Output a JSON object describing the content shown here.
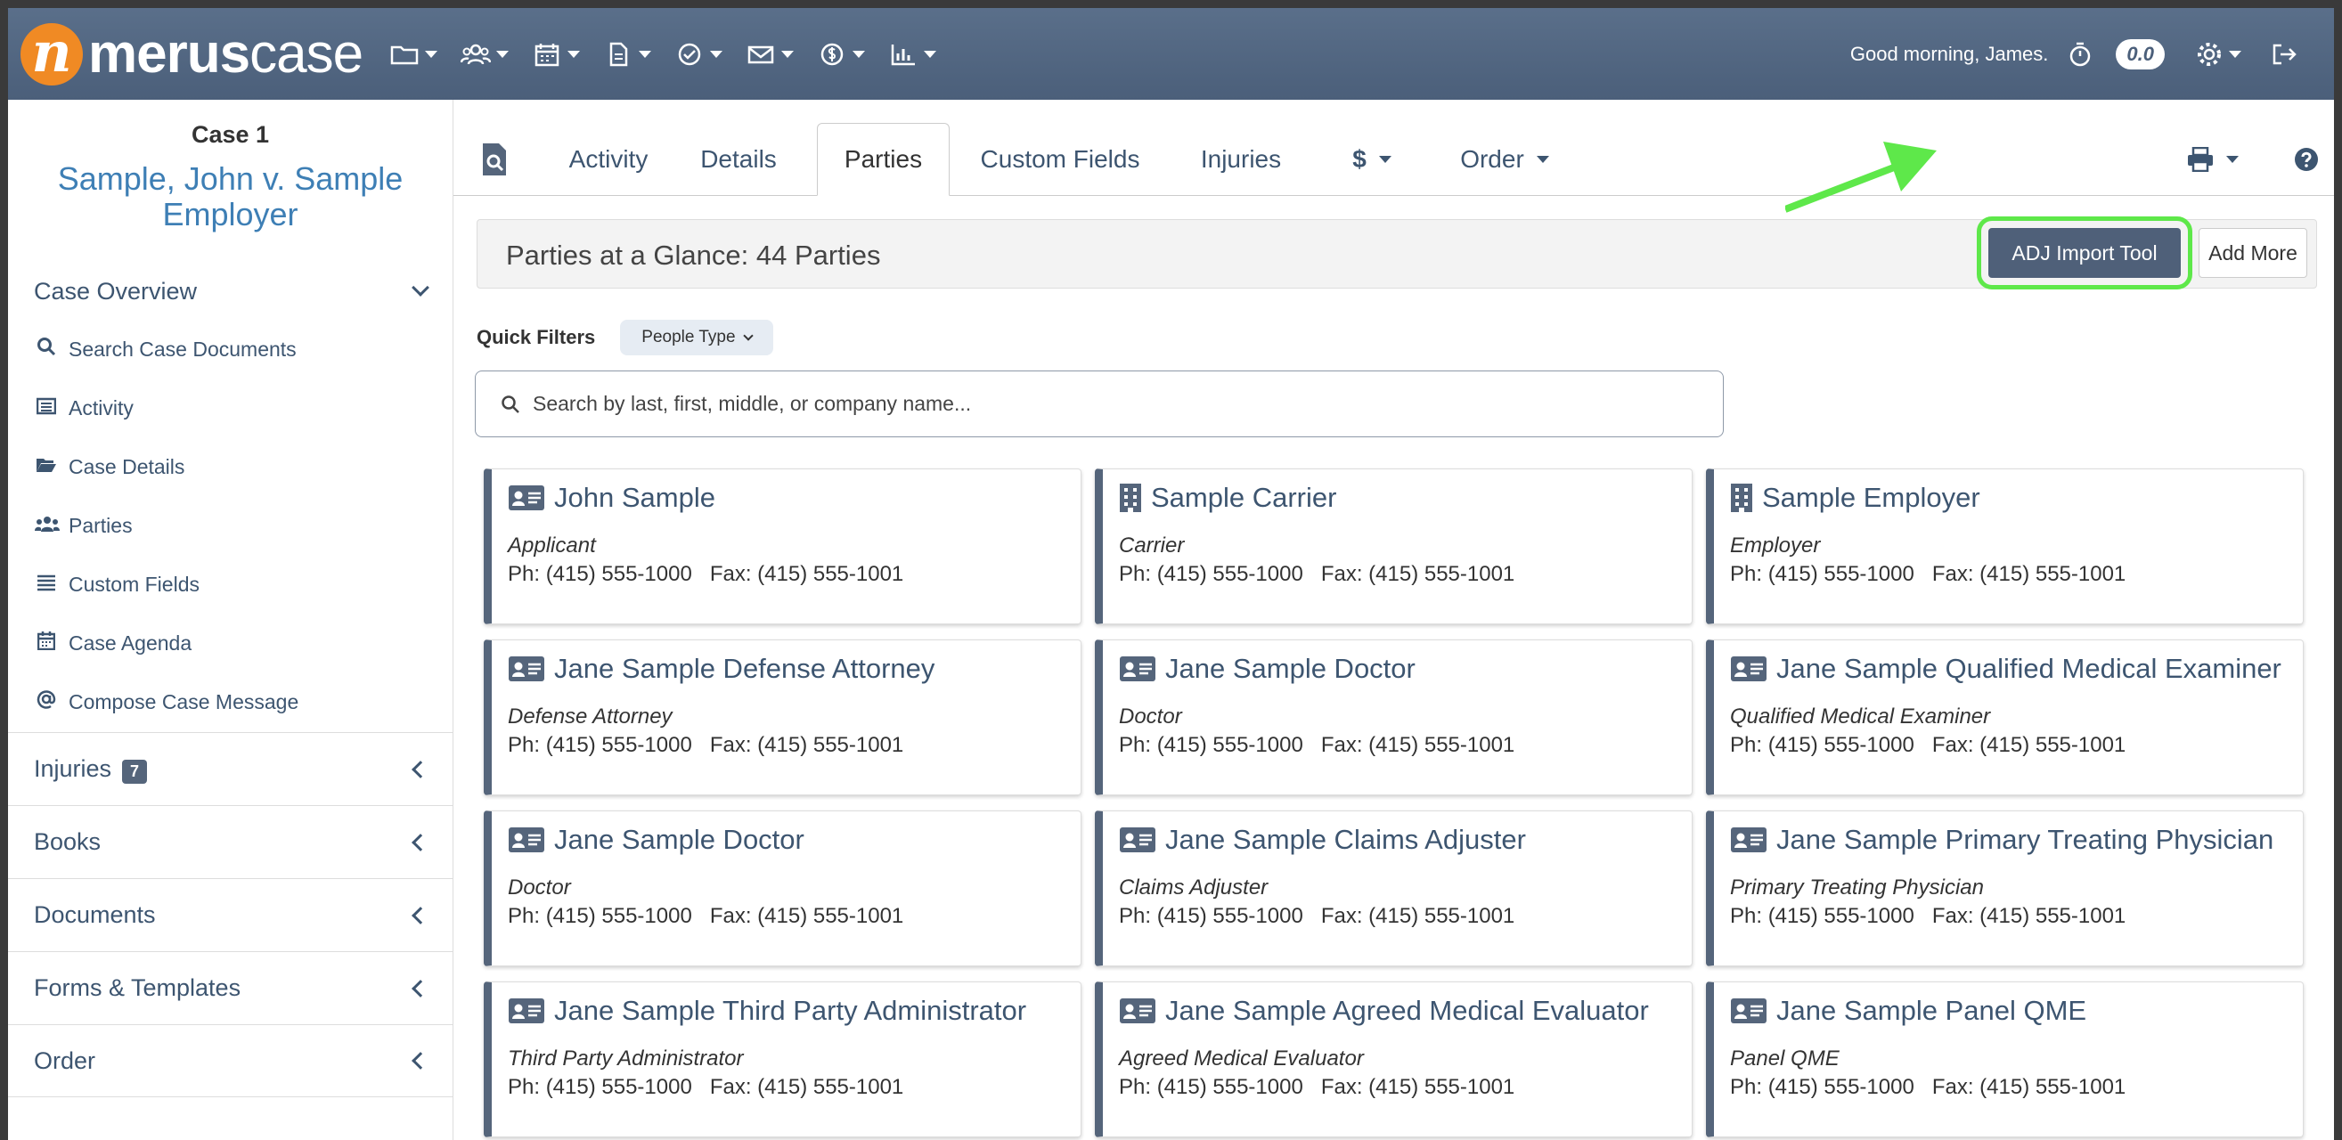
{
  "header": {
    "logo_mark": "n",
    "logo_bold": "merus",
    "logo_light": "case",
    "greeting": "Good morning, James.",
    "timer_value": "0.0"
  },
  "sidebar": {
    "case_number": "Case 1",
    "case_name": "Sample, John v. Sample Employer",
    "overview_title": "Case Overview",
    "links": [
      {
        "label": "Search Case Documents",
        "icon": "search-icon"
      },
      {
        "label": "Activity",
        "icon": "list-icon"
      },
      {
        "label": "Case Details",
        "icon": "folder-open-icon"
      },
      {
        "label": "Parties",
        "icon": "users-icon"
      },
      {
        "label": "Custom Fields",
        "icon": "lines-icon"
      },
      {
        "label": "Case Agenda",
        "icon": "calendar-icon"
      },
      {
        "label": "Compose Case Message",
        "icon": "at-icon"
      }
    ],
    "sections": [
      {
        "label": "Injuries",
        "badge": "7"
      },
      {
        "label": "Books"
      },
      {
        "label": "Documents"
      },
      {
        "label": "Forms & Templates"
      },
      {
        "label": "Order"
      }
    ]
  },
  "tabs": {
    "activity": "Activity",
    "details": "Details",
    "parties": "Parties",
    "custom_fields": "Custom Fields",
    "injuries": "Injuries",
    "dollar": "$",
    "order": "Order"
  },
  "glance": {
    "title": "Parties at a Glance: 44 Parties",
    "adj_button": "ADJ Import Tool",
    "add_more": "Add More"
  },
  "filters": {
    "label": "Quick Filters",
    "people_type": "People Type"
  },
  "search": {
    "placeholder": "Search by last, first, middle, or company name..."
  },
  "colors": {
    "navbar": "#4b5f7a",
    "accent_link": "#3e7fb5",
    "logo_orange": "#f08a24",
    "highlight_green": "#5ee84a"
  },
  "parties": [
    {
      "name": "John Sample",
      "role": "Applicant",
      "phone": "Ph: (415) 555-1000   Fax: (415) 555-1001",
      "icon": "id-card-icon"
    },
    {
      "name": "Sample Carrier",
      "role": "Carrier",
      "phone": "Ph: (415) 555-1000   Fax: (415) 555-1001",
      "icon": "building-icon"
    },
    {
      "name": "Sample Employer",
      "role": "Employer",
      "phone": "Ph: (415) 555-1000   Fax: (415) 555-1001",
      "icon": "building-icon"
    },
    {
      "name": "Jane Sample Defense Attorney",
      "role": "Defense Attorney",
      "phone": "Ph: (415) 555-1000   Fax: (415) 555-1001",
      "icon": "id-card-icon"
    },
    {
      "name": "Jane Sample Doctor",
      "role": "Doctor",
      "phone": "Ph: (415) 555-1000   Fax: (415) 555-1001",
      "icon": "id-card-icon"
    },
    {
      "name": "Jane Sample Qualified Medical Examiner",
      "role": "Qualified Medical Examiner",
      "phone": "Ph: (415) 555-1000   Fax: (415) 555-1001",
      "icon": "id-card-icon"
    },
    {
      "name": "Jane Sample Doctor",
      "role": "Doctor",
      "phone": "Ph: (415) 555-1000   Fax: (415) 555-1001",
      "icon": "id-card-icon"
    },
    {
      "name": "Jane Sample Claims Adjuster",
      "role": "Claims Adjuster",
      "phone": "Ph: (415) 555-1000   Fax: (415) 555-1001",
      "icon": "id-card-icon"
    },
    {
      "name": "Jane Sample Primary Treating Physician",
      "role": "Primary Treating Physician",
      "phone": "Ph: (415) 555-1000   Fax: (415) 555-1001",
      "icon": "id-card-icon"
    },
    {
      "name": "Jane Sample Third Party Administrator",
      "role": "Third Party Administrator",
      "phone": "Ph: (415) 555-1000   Fax: (415) 555-1001",
      "icon": "id-card-icon"
    },
    {
      "name": "Jane Sample Agreed Medical Evaluator",
      "role": "Agreed Medical Evaluator",
      "phone": "Ph: (415) 555-1000   Fax: (415) 555-1001",
      "icon": "id-card-icon"
    },
    {
      "name": "Jane Sample Panel QME",
      "role": "Panel QME",
      "phone": "Ph: (415) 555-1000   Fax: (415) 555-1001",
      "icon": "id-card-icon"
    }
  ]
}
